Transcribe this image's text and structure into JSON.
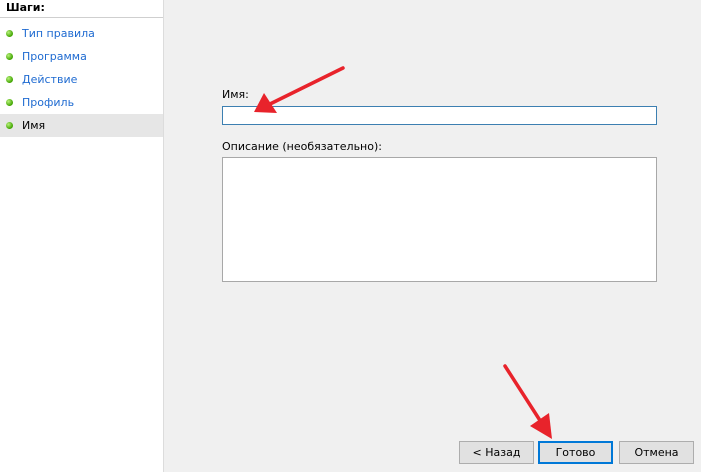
{
  "steps": {
    "header": "Шаги:",
    "items": [
      {
        "label": "Тип правила",
        "active": false
      },
      {
        "label": "Программа",
        "active": false
      },
      {
        "label": "Действие",
        "active": false
      },
      {
        "label": "Профиль",
        "active": false
      },
      {
        "label": "Имя",
        "active": true
      }
    ]
  },
  "form": {
    "name_label": "Имя:",
    "name_value": "",
    "description_label": "Описание (необязательно):",
    "description_value": ""
  },
  "buttons": {
    "back": "< Назад",
    "finish": "Готово",
    "cancel": "Отмена"
  },
  "annotations": {
    "arrow_color": "#e8232b"
  }
}
